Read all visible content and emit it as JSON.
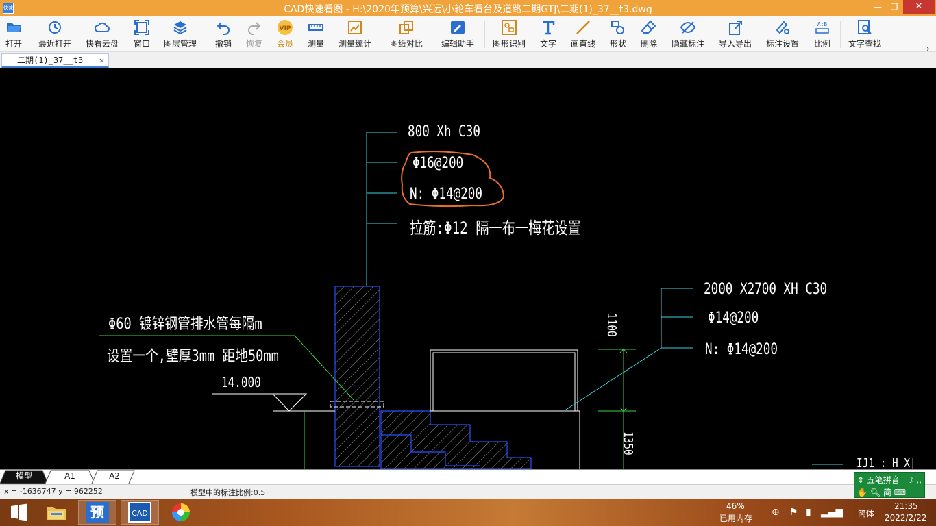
{
  "window": {
    "title": "CAD快速看图 - H:\\2020年预算\\兴远\\小轮车看台及道路二期GTJ\\二期(1)_37__t3.dwg",
    "app_icon_text": "快速",
    "minimize": "—",
    "maximize": "❐",
    "close": "✕"
  },
  "toolbar": {
    "items": [
      {
        "label": "打开",
        "icon": "folder-open-icon"
      },
      {
        "label": "最近打开",
        "icon": "recent-icon"
      },
      {
        "label": "快看云盘",
        "icon": "cloud-icon"
      },
      {
        "label": "窗口",
        "icon": "window-icon"
      },
      {
        "label": "图层管理",
        "icon": "layers-icon"
      },
      {
        "label": "撤销",
        "icon": "undo-icon"
      },
      {
        "label": "恢复",
        "icon": "redo-icon"
      },
      {
        "label": "会员",
        "icon": "vip-icon"
      },
      {
        "label": "测量",
        "icon": "ruler-icon"
      },
      {
        "label": "测量统计",
        "icon": "measure-stats-icon"
      },
      {
        "label": "图纸对比",
        "icon": "compare-icon"
      },
      {
        "label": "编辑助手",
        "icon": "edit-assistant-icon"
      },
      {
        "label": "图形识别",
        "icon": "shape-recognize-icon"
      },
      {
        "label": "文字",
        "icon": "text-icon"
      },
      {
        "label": "画直线",
        "icon": "line-icon"
      },
      {
        "label": "形状",
        "icon": "shape-icon"
      },
      {
        "label": "删除",
        "icon": "eraser-icon"
      },
      {
        "label": "隐藏标注",
        "icon": "eye-hide-icon"
      },
      {
        "label": "导入导出",
        "icon": "import-export-icon"
      },
      {
        "label": "标注设置",
        "icon": "annotation-settings-icon"
      },
      {
        "label": "比例",
        "icon": "scale-icon"
      },
      {
        "label": "文字查找",
        "icon": "text-search-icon"
      }
    ],
    "more": "›",
    "vip_badge": "VIP"
  },
  "document_tab": {
    "label": "二期(1)_37__t3",
    "close": "✕"
  },
  "drawing": {
    "texts": {
      "col_size": "800 Xh     C30",
      "col_rebar1": "Φ16@200",
      "col_rebar2": "N: Φ14@200",
      "col_tie": "拉筋:Φ12 隔一布一梅花设置",
      "drain1": "Φ60 镀锌钢管排水管每隔",
      "drain1_tail": "m",
      "drain2": "设置一个,壁厚3mm  距地",
      "drain2_tail": "50mm",
      "elevation": "14.000",
      "beam_size": "2000   X2700  XH  C30",
      "beam_rebar1": "Φ14@200",
      "beam_rebar2": "N: Φ14@200",
      "dim_1100": "1100",
      "dim_1350": "1350",
      "cutoff": "IJ1 : H X|"
    }
  },
  "layout_tabs": [
    "模型",
    "A1",
    "A2"
  ],
  "status": {
    "coords": "x = -1636747  y = 962252",
    "scale": "模型中的标注比例:0.5"
  },
  "ime": {
    "name": "五笔拼音",
    "mode": "简",
    "symbols": "☽ ,,"
  },
  "taskbar": {
    "apps": [
      "start-icon",
      "file-explorer-icon",
      "预",
      "CAD",
      "browser-icon"
    ],
    "memory_percent": "46%",
    "memory_label": "已用内存",
    "lang": "简体",
    "time": "21:35",
    "date": "2022/2/22"
  }
}
